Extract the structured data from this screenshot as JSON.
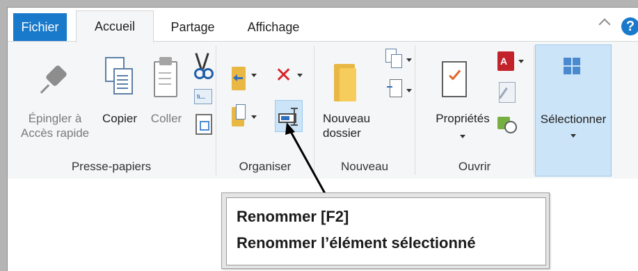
{
  "tabs": {
    "file": "Fichier",
    "home": "Accueil",
    "share": "Partage",
    "view": "Affichage"
  },
  "help_label": "?",
  "clipboard": {
    "pin_line1": "Épingler à",
    "pin_line2": "Accès rapide",
    "copy": "Copier",
    "paste": "Coller",
    "group": "Presse-papiers"
  },
  "organize": {
    "group": "Organiser"
  },
  "new": {
    "folder_line1": "Nouveau",
    "folder_line2": "dossier",
    "group": "Nouveau"
  },
  "open": {
    "properties": "Propriétés",
    "group": "Ouvrir"
  },
  "select": {
    "label": "Sélectionner"
  },
  "tooltip": {
    "title": "Renommer [F2]",
    "description": "Renommer l’élément sélectionné"
  },
  "colors": {
    "file_tab": "#1979ca",
    "ribbon_bg": "#f5f6f7",
    "delete_red": "#d8232a",
    "highlight": "#cce4f7"
  }
}
